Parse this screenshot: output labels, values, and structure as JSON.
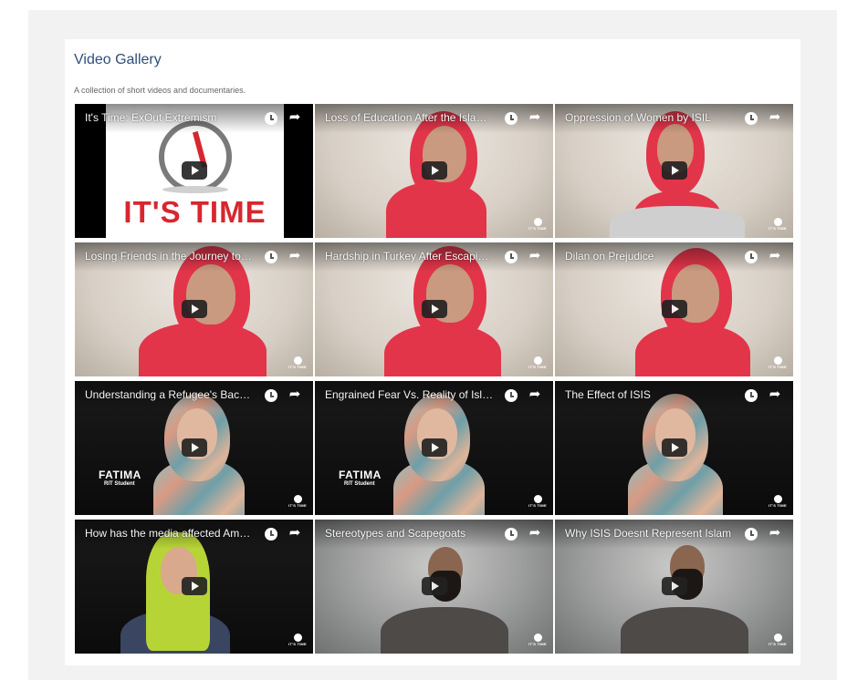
{
  "gallery": {
    "title": "Video Gallery",
    "subtitle": "A collection of short videos and documentaries."
  },
  "logo": {
    "text": "IT'S TIME"
  },
  "brand_mark": "IT'S TIME",
  "caption": {
    "name": "FATIMA",
    "role": "RIT Student"
  },
  "icons": {
    "watch_later": "clock-icon",
    "share": "share-arrow-icon",
    "play": "play-icon"
  },
  "colors": {
    "accent_title": "#2f4f78",
    "hijab_red": "#e2354a",
    "logo_red": "#d8262f",
    "panel": "#f2f2f2"
  },
  "videos": [
    {
      "title": "It's Time: ExOut Extremism"
    },
    {
      "title": "Loss of Education After the Islamic State"
    },
    {
      "title": "Oppression of Women by ISIL"
    },
    {
      "title": "Losing Friends in the Journey to Escape"
    },
    {
      "title": "Hardship in Turkey After Escaping ISIS"
    },
    {
      "title": "Dilan on Prejudice"
    },
    {
      "title": "Understanding a Refugee's Back Story"
    },
    {
      "title": "Engrained Fear Vs. Reality of Islam"
    },
    {
      "title": "The Effect of ISIS"
    },
    {
      "title": "How has the media affected American Muslims"
    },
    {
      "title": "Stereotypes and Scapegoats"
    },
    {
      "title": "Why ISIS Doesnt Represent Islam"
    }
  ]
}
